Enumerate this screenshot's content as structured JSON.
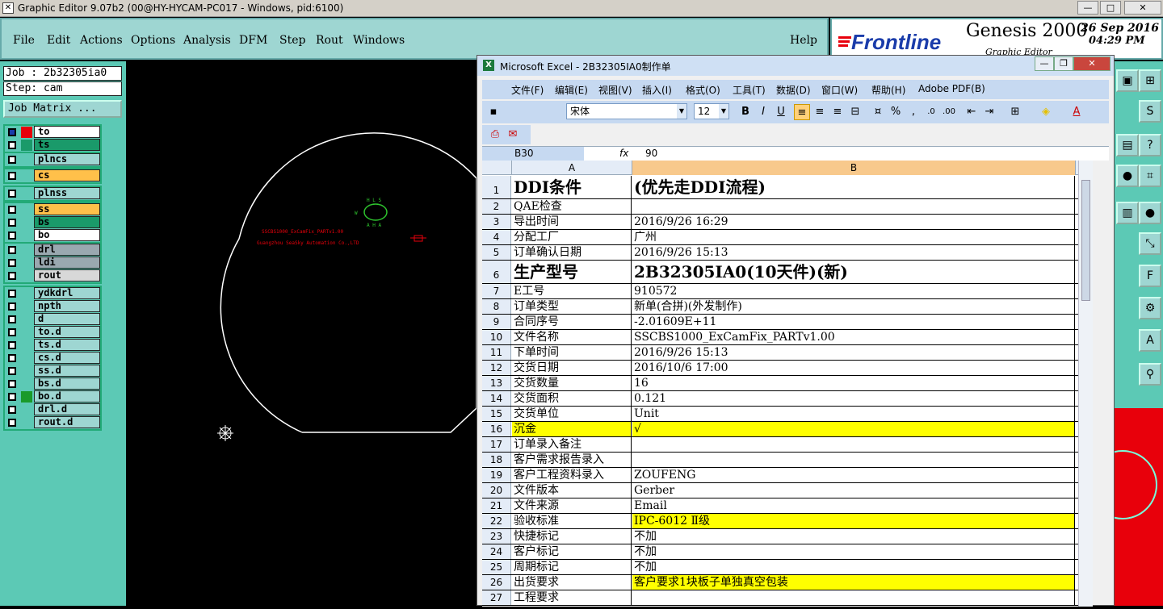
{
  "genesis": {
    "window_title": "Graphic Editor 9.07b2 (00@HY-HYCAM-PC017 - Windows, pid:6100)",
    "menu": [
      "File",
      "Edit",
      "Actions",
      "Options",
      "Analysis",
      "DFM",
      "Step",
      "Rout",
      "Windows"
    ],
    "help": "Help",
    "brand": "Frontline",
    "product": "Genesis 2000",
    "product_sub": "Graphic Editor",
    "date": "26 Sep 2016",
    "time": "04:29 PM",
    "job_label": "Job : 2b32305ia0",
    "step_label": "Step: cam",
    "job_matrix": "Job Matrix ...",
    "layer_groups": [
      [
        {
          "name": "to",
          "color": "#ffffff",
          "swatch": "#e8000b",
          "checked": true
        },
        {
          "name": "ts",
          "color": "#1a9a6a",
          "swatch": "#1a9a6a",
          "checked": false
        }
      ],
      [
        {
          "name": "plncs",
          "color": "#9ed6d2",
          "swatch": "",
          "checked": false
        }
      ],
      [
        {
          "name": "cs",
          "color": "#ffc04a",
          "swatch": "",
          "checked": false
        }
      ],
      [
        {
          "name": "plnss",
          "color": "#9ed6d2",
          "swatch": "",
          "checked": false
        }
      ],
      [
        {
          "name": "ss",
          "color": "#ffc04a",
          "swatch": "",
          "checked": false
        },
        {
          "name": "bs",
          "color": "#1a9a6a",
          "swatch": "",
          "checked": false
        },
        {
          "name": "bo",
          "color": "#ffffff",
          "swatch": "",
          "checked": false
        }
      ],
      [
        {
          "name": "drl",
          "color": "#9aa8b0",
          "swatch": "",
          "checked": false
        },
        {
          "name": "ldi",
          "color": "#9aa8b0",
          "swatch": "",
          "checked": false
        },
        {
          "name": "rout",
          "color": "#d8d8d8",
          "swatch": "",
          "checked": false
        }
      ],
      [
        {
          "name": "ydkdrl",
          "color": "#9ed6d2",
          "swatch": "",
          "checked": false
        },
        {
          "name": "npth",
          "color": "#9ed6d2",
          "swatch": "",
          "checked": false
        },
        {
          "name": "d",
          "color": "#9ed6d2",
          "swatch": "",
          "checked": false
        },
        {
          "name": "to.d",
          "color": "#9ed6d2",
          "swatch": "",
          "checked": false
        },
        {
          "name": "ts.d",
          "color": "#9ed6d2",
          "swatch": "",
          "checked": false
        },
        {
          "name": "cs.d",
          "color": "#9ed6d2",
          "swatch": "",
          "checked": false
        },
        {
          "name": "ss.d",
          "color": "#9ed6d2",
          "swatch": "",
          "checked": false
        },
        {
          "name": "bs.d",
          "color": "#9ed6d2",
          "swatch": "",
          "checked": false
        },
        {
          "name": "bo.d",
          "color": "#9ed6d2",
          "swatch": "#1a9a2a",
          "checked": false
        },
        {
          "name": "drl.d",
          "color": "#9ed6d2",
          "swatch": "",
          "checked": false
        },
        {
          "name": "rout.d",
          "color": "#9ed6d2",
          "swatch": "",
          "checked": false
        }
      ]
    ],
    "canvas_text_1": "SSCBS1000_ExCamFix_PARTv1.00",
    "canvas_text_2": "Guangzhou SeaSky Automation Co.,LTD"
  },
  "excel": {
    "window_title": "Microsoft Excel - 2B32305IA0制作单",
    "menu": [
      "文件(F)",
      "编辑(E)",
      "视图(V)",
      "插入(I)",
      "格式(O)",
      "工具(T)",
      "数据(D)",
      "窗口(W)",
      "帮助(H)",
      "Adobe PDF(B)"
    ],
    "font_name": "宋体",
    "font_size": "12",
    "cell_ref": "B30",
    "formula_value": "90",
    "col_a": "A",
    "col_b": "B",
    "rows": [
      {
        "n": "1",
        "a": "DDI条件",
        "b": "(优先走DDI流程)",
        "big": true,
        "yellow": false
      },
      {
        "n": "2",
        "a": "QAE检查",
        "b": "",
        "big": false,
        "yellow": false
      },
      {
        "n": "3",
        "a": "导出时间",
        "b": "2016/9/26 16:29",
        "big": false,
        "yellow": false
      },
      {
        "n": "4",
        "a": "分配工厂",
        "b": "广州",
        "big": false,
        "yellow": false
      },
      {
        "n": "5",
        "a": "订单确认日期",
        "b": "2016/9/26 15:13",
        "big": false,
        "yellow": false
      },
      {
        "n": "6",
        "a": "生产型号",
        "b": "2B32305IA0(10天件)(新)",
        "big": true,
        "yellow": false
      },
      {
        "n": "7",
        "a": "E工号",
        "b": "910572",
        "big": false,
        "yellow": false
      },
      {
        "n": "8",
        "a": "订单类型",
        "b": "新单(合拼)(外发制作)",
        "big": false,
        "yellow": false
      },
      {
        "n": "9",
        "a": "合同序号",
        "b": "-2.01609E+11",
        "big": false,
        "yellow": false
      },
      {
        "n": "10",
        "a": "文件名称",
        "b": "SSCBS1000_ExCamFix_PARTv1.00",
        "big": false,
        "yellow": false
      },
      {
        "n": "11",
        "a": "下单时间",
        "b": "2016/9/26 15:13",
        "big": false,
        "yellow": false
      },
      {
        "n": "12",
        "a": "交货日期",
        "b": "2016/10/6 17:00",
        "big": false,
        "yellow": false
      },
      {
        "n": "13",
        "a": "交货数量",
        "b": "16",
        "big": false,
        "yellow": false
      },
      {
        "n": "14",
        "a": "交货面积",
        "b": "0.121",
        "big": false,
        "yellow": false
      },
      {
        "n": "15",
        "a": "交货单位",
        "b": "Unit",
        "big": false,
        "yellow": false
      },
      {
        "n": "16",
        "a": "沉金",
        "b": "√",
        "big": false,
        "yellow": true
      },
      {
        "n": "17",
        "a": "订单录入备注",
        "b": "",
        "big": false,
        "yellow": false
      },
      {
        "n": "18",
        "a": "客户需求报告录入",
        "b": "",
        "big": false,
        "yellow": false
      },
      {
        "n": "19",
        "a": "客户工程资料录入",
        "b": "ZOUFENG",
        "big": false,
        "yellow": false
      },
      {
        "n": "20",
        "a": "文件版本",
        "b": "Gerber",
        "big": false,
        "yellow": false
      },
      {
        "n": "21",
        "a": "文件来源",
        "b": "Email",
        "big": false,
        "yellow": false
      },
      {
        "n": "22",
        "a": "验收标准",
        "b": "IPC-6012 Ⅱ级",
        "big": false,
        "yellow": "b"
      },
      {
        "n": "23",
        "a": "快捷标记",
        "b": "不加",
        "big": false,
        "yellow": false
      },
      {
        "n": "24",
        "a": "客户标记",
        "b": "不加",
        "big": false,
        "yellow": false
      },
      {
        "n": "25",
        "a": "周期标记",
        "b": "不加",
        "big": false,
        "yellow": false
      },
      {
        "n": "26",
        "a": "出货要求",
        "b": "客户要求1块板子单独真空包装",
        "big": false,
        "yellow": "b"
      },
      {
        "n": "27",
        "a": "工程要求",
        "b": "",
        "big": false,
        "yellow": false
      }
    ]
  }
}
